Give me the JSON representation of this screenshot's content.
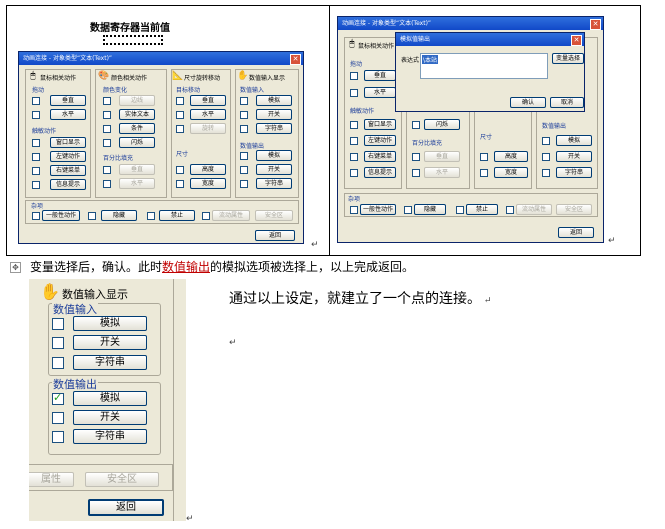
{
  "top_left": {
    "header_title": "数据寄存器当前值",
    "window_title": "动画连接 - 对象类型“文本(Text)”",
    "groups": {
      "mouse": "鼠标相关动作",
      "color": "颜色相关动作",
      "size": "尺寸旋转移动",
      "numeric": "数值输入显示"
    },
    "mouse": {
      "drag_label": "拖动",
      "vertical": "垂直",
      "horizontal": "水平",
      "touch_label": "触敏动作",
      "window_show": "窗口显示",
      "left_key": "左键动作",
      "right_menu": "右键菜单",
      "info_tip": "信息提示"
    },
    "color": {
      "fill_label": "颜色变化",
      "border": "边线",
      "solid_text": "实体文本",
      "condition": "条件",
      "flash": "闪烁",
      "percent_label": "百分比填充",
      "vertical": "垂直",
      "horizontal": "水平"
    },
    "size": {
      "move_label": "目标移动",
      "vertical": "垂直",
      "horizontal": "水平",
      "rotate": "旋转",
      "dim_label": "尺寸",
      "height": "高度",
      "width": "宽度"
    },
    "numeric": {
      "in_label": "数值输入",
      "in_analog": "模拟",
      "in_switch": "开关",
      "in_string": "字符串",
      "out_label": "数值输出",
      "out_analog": "模拟",
      "out_switch": "开关",
      "out_string": "字符串"
    },
    "misc": {
      "label": "杂项",
      "general": "一般性动作",
      "hide": "隐藏",
      "disable": "禁止",
      "flow": "流动属性",
      "safe": "安全区"
    },
    "return": "返回"
  },
  "top_right": {
    "window_title": "动画连接 - 对象类型“文本(Text)”",
    "popup_title": "模拟值输出",
    "expr_label": "表达式",
    "expr_value": "\\本站",
    "var_select": "变量选择",
    "ok": "确认",
    "cancel": "取消",
    "mouse": "鼠标相关动作",
    "drag_label": "拖动",
    "vertical": "垂直",
    "horizontal": "水平",
    "touch_label": "触敏动作",
    "window_show": "窗口显示",
    "left_key": "左键动作",
    "right_menu": "右键菜单",
    "info_tip": "信息提示",
    "flash": "闪烁",
    "percent_label": "百分比填充",
    "p_vertical": "垂直",
    "p_horizontal": "水平",
    "dim_label": "尺寸",
    "height": "高度",
    "width": "宽度",
    "out_label": "数值输出",
    "out_analog": "模拟",
    "out_switch": "开关",
    "out_string": "字符串",
    "misc_label": "杂项",
    "general": "一般性动作",
    "hide": "隐藏",
    "disable": "禁止",
    "flow": "流动属性",
    "safe": "安全区",
    "return": "返回"
  },
  "caption": {
    "before": "变量选择后，确认。此时",
    "highlight": "数值输出",
    "after": "的模拟选项被选择上，以上完成返回。"
  },
  "crop": {
    "group_title": "数值输入显示",
    "in_label": "数值输入",
    "in_analog": "模拟",
    "in_switch": "开关",
    "in_string": "字符串",
    "out_label": "数值输出",
    "out_analog": "模拟",
    "out_switch": "开关",
    "out_string": "字符串",
    "attr": "属性",
    "safe": "安全区",
    "return": "返回"
  },
  "summary": "通过以上设定，就建立了一个点的连接。",
  "colors": {
    "titlebar": "#1F5FD6",
    "dialog_bg": "#ECE9D8",
    "highlight_text": "#C00000",
    "label_blue": "#1A3C9A",
    "check_green": "#1E9E1E"
  }
}
